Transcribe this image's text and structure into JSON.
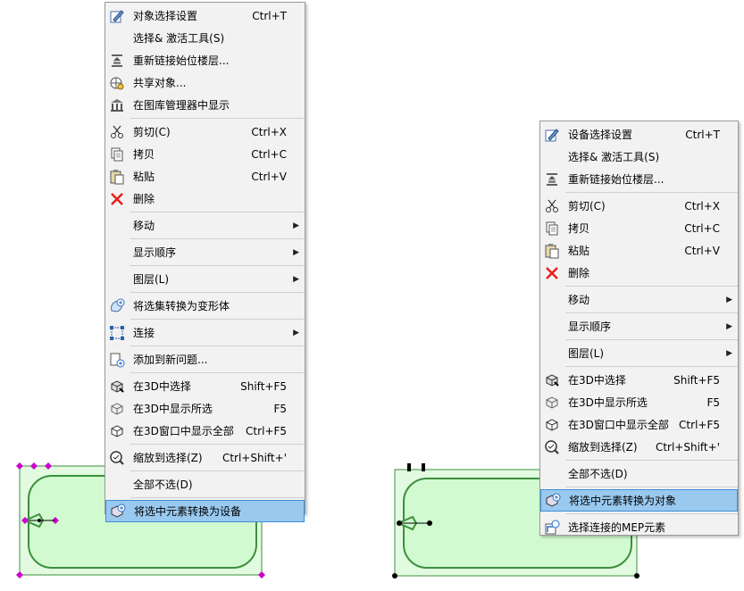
{
  "colors": {
    "menu_bg": "#f2f2f2",
    "highlight_bg": "#99c9ef",
    "highlight_border": "#3d8ed6",
    "shape_fill": "#d1fad0",
    "shape_stroke": "#3c8f3c",
    "left_handle": "#cc00cc",
    "right_handle": "#000000",
    "delete_icon": "#e8201a"
  },
  "menu_left": {
    "items": [
      {
        "id": "obj-settings",
        "icon": "pencil-settings-icon",
        "label": "对象选择设置",
        "shortcut": "Ctrl+T"
      },
      {
        "id": "select-activate",
        "icon": "",
        "label": "选择& 激活工具(S)",
        "shortcut": ""
      },
      {
        "id": "relink-floor",
        "icon": "relink-floor-icon",
        "label": "重新链接始位楼层...",
        "shortcut": ""
      },
      {
        "id": "share",
        "icon": "share-globe-icon",
        "label": "共享对象...",
        "shortcut": ""
      },
      {
        "id": "library",
        "icon": "library-icon",
        "label": "在图库管理器中显示",
        "shortcut": ""
      },
      {
        "id": "cut",
        "icon": "scissors-icon",
        "label": "剪切(C)",
        "shortcut": "Ctrl+X"
      },
      {
        "id": "copy",
        "icon": "copy-icon",
        "label": "拷贝",
        "shortcut": "Ctrl+C"
      },
      {
        "id": "paste",
        "icon": "paste-icon",
        "label": "粘贴",
        "shortcut": "Ctrl+V"
      },
      {
        "id": "delete",
        "icon": "delete-x-icon",
        "label": "删除",
        "shortcut": ""
      },
      {
        "id": "move",
        "icon": "",
        "label": "移动",
        "shortcut": ""
      },
      {
        "id": "display-order",
        "icon": "",
        "label": "显示顺序",
        "shortcut": ""
      },
      {
        "id": "layer",
        "icon": "",
        "label": "图层(L)",
        "shortcut": ""
      },
      {
        "id": "morph",
        "icon": "morph-icon",
        "label": "将选集转换为变形体",
        "shortcut": ""
      },
      {
        "id": "connect",
        "icon": "connect-icon",
        "label": "连接",
        "shortcut": ""
      },
      {
        "id": "add-issue",
        "icon": "add-issue-icon",
        "label": "添加到新问题...",
        "shortcut": ""
      },
      {
        "id": "select-3d",
        "icon": "cube-select-icon",
        "label": "在3D中选择",
        "shortcut": "Shift+F5"
      },
      {
        "id": "show-selected-3d",
        "icon": "cube-show-icon",
        "label": "在3D中显示所选",
        "shortcut": "F5"
      },
      {
        "id": "show-all-3d",
        "icon": "cube-all-icon",
        "label": "在3D窗口中显示全部",
        "shortcut": "Ctrl+F5"
      },
      {
        "id": "zoom-selection",
        "icon": "zoom-icon",
        "label": "缩放到选择(Z)",
        "shortcut": "Ctrl+Shift+'"
      },
      {
        "id": "deselect-all",
        "icon": "",
        "label": "全部不选(D)",
        "shortcut": ""
      },
      {
        "id": "convert-equipment",
        "icon": "convert-icon",
        "label": "将选中元素转换为设备",
        "shortcut": ""
      }
    ]
  },
  "menu_right": {
    "items": [
      {
        "id": "eq-settings",
        "icon": "pencil-settings-icon",
        "label": "设备选择设置",
        "shortcut": "Ctrl+T"
      },
      {
        "id": "select-activate",
        "icon": "",
        "label": "选择& 激活工具(S)",
        "shortcut": ""
      },
      {
        "id": "relink-floor",
        "icon": "relink-floor-icon",
        "label": "重新链接始位楼层...",
        "shortcut": ""
      },
      {
        "id": "cut",
        "icon": "scissors-icon",
        "label": "剪切(C)",
        "shortcut": "Ctrl+X"
      },
      {
        "id": "copy",
        "icon": "copy-icon",
        "label": "拷贝",
        "shortcut": "Ctrl+C"
      },
      {
        "id": "paste",
        "icon": "paste-icon",
        "label": "粘贴",
        "shortcut": "Ctrl+V"
      },
      {
        "id": "delete",
        "icon": "delete-x-icon",
        "label": "删除",
        "shortcut": ""
      },
      {
        "id": "move",
        "icon": "",
        "label": "移动",
        "shortcut": ""
      },
      {
        "id": "display-order",
        "icon": "",
        "label": "显示顺序",
        "shortcut": ""
      },
      {
        "id": "layer",
        "icon": "",
        "label": "图层(L)",
        "shortcut": ""
      },
      {
        "id": "select-3d",
        "icon": "cube-select-icon",
        "label": "在3D中选择",
        "shortcut": "Shift+F5"
      },
      {
        "id": "show-selected-3d",
        "icon": "cube-show-icon",
        "label": "在3D中显示所选",
        "shortcut": "F5"
      },
      {
        "id": "show-all-3d",
        "icon": "cube-all-icon",
        "label": "在3D窗口中显示全部",
        "shortcut": "Ctrl+F5"
      },
      {
        "id": "zoom-selection",
        "icon": "zoom-icon",
        "label": "缩放到选择(Z)",
        "shortcut": "Ctrl+Shift+'"
      },
      {
        "id": "deselect-all",
        "icon": "",
        "label": "全部不选(D)",
        "shortcut": ""
      },
      {
        "id": "convert-object",
        "icon": "convert-icon",
        "label": "将选中元素转换为对象",
        "shortcut": ""
      },
      {
        "id": "select-mep",
        "icon": "mep-icon",
        "label": "选择连接的MEP元素",
        "shortcut": ""
      }
    ]
  }
}
